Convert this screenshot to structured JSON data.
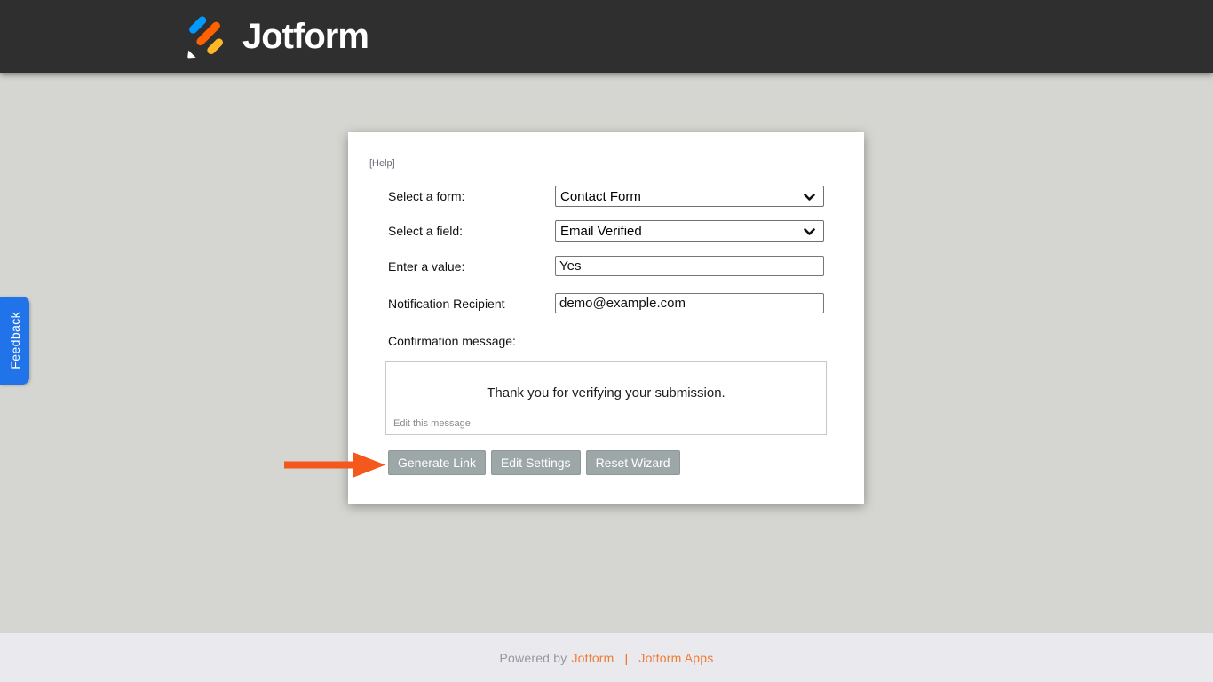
{
  "header": {
    "brand": "Jotform"
  },
  "feedback_tab": {
    "label": "Feedback"
  },
  "wizard": {
    "help_link": "[Help]",
    "fields": [
      {
        "label": "Select a form:",
        "value": "Contact Form"
      },
      {
        "label": "Select a field:",
        "value": "Email Verified"
      },
      {
        "label": "Enter a value:",
        "value": "Yes"
      },
      {
        "label": "Notification Recipient",
        "value": "demo@example.com"
      }
    ],
    "confirmation_label": "Confirmation message:",
    "confirmation_message": "Thank you for verifying your submission.",
    "edit_message_link": "Edit this message",
    "buttons": [
      {
        "label": "Generate Link"
      },
      {
        "label": "Edit Settings"
      },
      {
        "label": "Reset Wizard"
      }
    ]
  },
  "footer": {
    "powered_by": "Powered by",
    "jotform_link": "Jotform",
    "separator": "|",
    "apps_link": "Jotform Apps"
  },
  "colors": {
    "header_bg": "#2f2f2f",
    "page_bg": "#d5d6d1",
    "footer_bg": "#e9e9ee",
    "button_bg": "#9da7a7",
    "arrow_orange": "#f4581c",
    "feedback_blue": "#2173e9",
    "footer_link_orange": "#ef7b35",
    "logo_blue": "#0099ff",
    "logo_orange": "#ff6100",
    "logo_yellow": "#ffb629"
  }
}
